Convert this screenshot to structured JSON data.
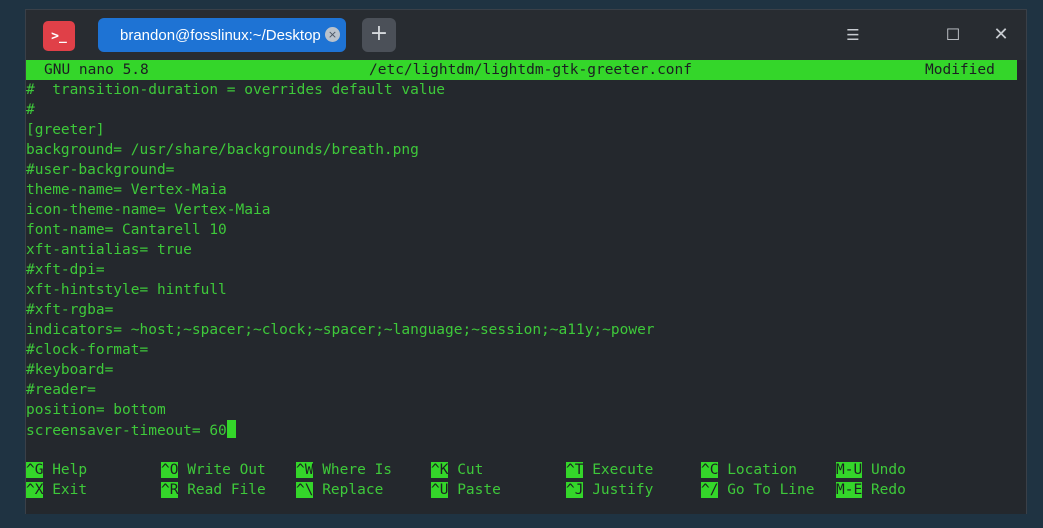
{
  "titlebar": {
    "app_icon_glyph": ">_",
    "tab_title": "brandon@fosslinux:~/Desktop",
    "tab_close_glyph": "×",
    "new_tab_glyph": "+",
    "menu_glyph": "☰",
    "maximize_glyph": "☐",
    "close_glyph": "✕"
  },
  "nano": {
    "version": "GNU nano 5.8",
    "filename": "/etc/lightdm/lightdm-gtk-greeter.conf",
    "state": "Modified"
  },
  "lines": [
    "#  transition-duration = overrides default value",
    "#",
    "[greeter]",
    "background= /usr/share/backgrounds/breath.png",
    "#user-background=",
    "theme-name= Vertex-Maia",
    "icon-theme-name= Vertex-Maia",
    "font-name= Cantarell 10",
    "xft-antialias= true",
    "#xft-dpi=",
    "xft-hintstyle= hintfull",
    "#xft-rgba=",
    "indicators= ~host;~spacer;~clock;~spacer;~language;~session;~a11y;~power",
    "#clock-format=",
    "#keyboard=",
    "#reader=",
    "position= bottom",
    "screensaver-timeout= 60"
  ],
  "shortcuts": [
    {
      "key": "^G",
      "label": "Help"
    },
    {
      "key": "^X",
      "label": "Exit"
    },
    {
      "key": "^O",
      "label": "Write Out"
    },
    {
      "key": "^R",
      "label": "Read File"
    },
    {
      "key": "^W",
      "label": "Where Is"
    },
    {
      "key": "^\\",
      "label": "Replace"
    },
    {
      "key": "^K",
      "label": "Cut"
    },
    {
      "key": "^U",
      "label": "Paste"
    },
    {
      "key": "^T",
      "label": "Execute"
    },
    {
      "key": "^J",
      "label": "Justify"
    },
    {
      "key": "^C",
      "label": "Location"
    },
    {
      "key": "^/",
      "label": "Go To Line"
    },
    {
      "key": "M-U",
      "label": "Undo"
    },
    {
      "key": "M-E",
      "label": "Redo"
    }
  ],
  "colors": {
    "terminal_text": "#3ec93a",
    "status_bar": "#34d62a",
    "tab_active": "#1e73d4",
    "app_icon": "#e04048"
  }
}
